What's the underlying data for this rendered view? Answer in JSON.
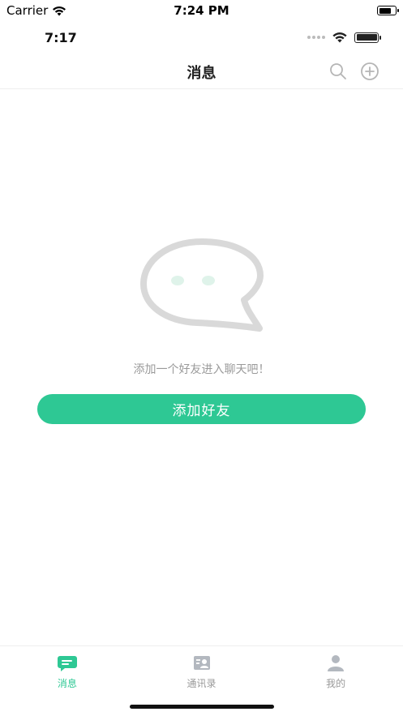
{
  "simulator_status": {
    "carrier": "Carrier",
    "time": "7:24 PM"
  },
  "app_status": {
    "time": "7:17"
  },
  "navbar": {
    "title": "消息",
    "search_icon": "search-icon",
    "add_icon": "plus-circle-icon"
  },
  "empty_state": {
    "illustration": "chat-bubble-icon",
    "message": "添加一个好友进入聊天吧！",
    "button_label": "添加好友"
  },
  "tabbar": {
    "items": [
      {
        "label": "消息",
        "icon": "message-icon",
        "active": true
      },
      {
        "label": "通讯录",
        "icon": "contacts-icon",
        "active": false
      },
      {
        "label": "我的",
        "icon": "profile-icon",
        "active": false
      }
    ]
  },
  "colors": {
    "accent": "#2ec894",
    "inactive": "#999999",
    "divider": "#eeeeee"
  }
}
